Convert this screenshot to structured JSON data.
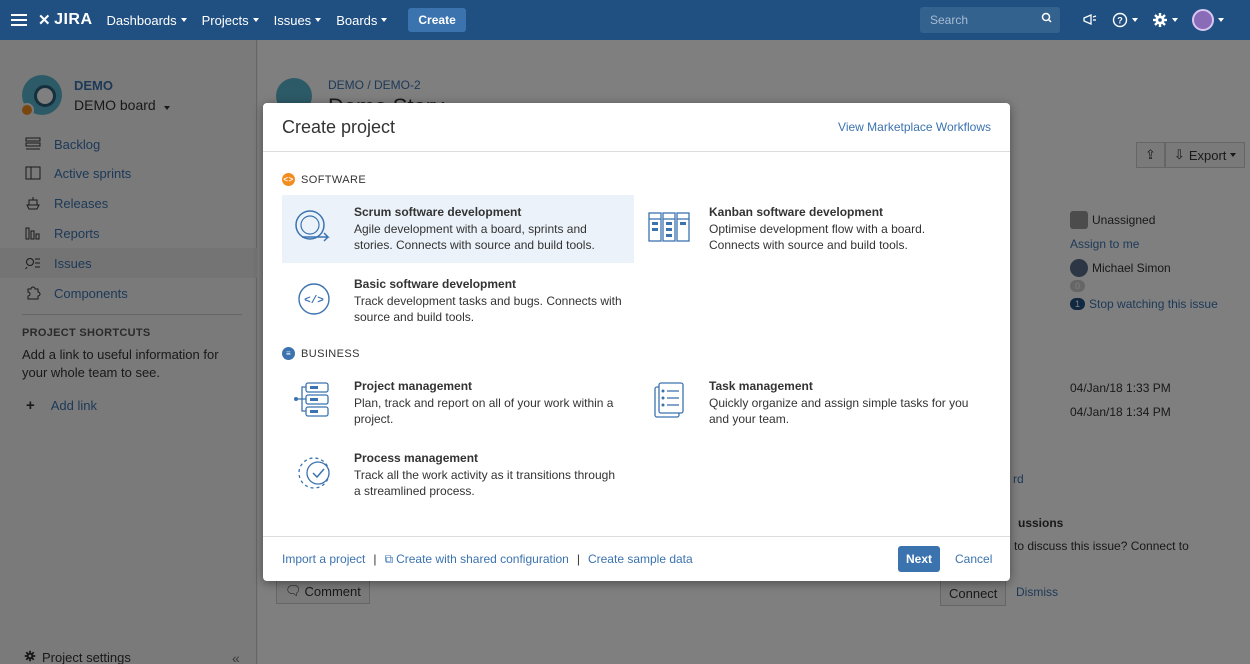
{
  "nav": {
    "logo": "JIRA",
    "items": [
      "Dashboards",
      "Projects",
      "Issues",
      "Boards"
    ],
    "create": "Create",
    "search_placeholder": "Search"
  },
  "sidebar": {
    "project_name": "DEMO",
    "board_name": "DEMO board",
    "items": [
      {
        "label": "Backlog",
        "icon": "backlog-icon"
      },
      {
        "label": "Active sprints",
        "icon": "sprint-icon"
      },
      {
        "label": "Releases",
        "icon": "ship-icon"
      },
      {
        "label": "Reports",
        "icon": "reports-icon"
      },
      {
        "label": "Issues",
        "icon": "issues-search-icon"
      },
      {
        "label": "Components",
        "icon": "puzzle-icon"
      }
    ],
    "shortcuts_title": "PROJECT SHORTCUTS",
    "shortcuts_text": "Add a link to useful information for your whole team to see.",
    "add_link": "Add link",
    "project_settings": "Project settings"
  },
  "issue": {
    "breadcrumb": "DEMO / DEMO-2",
    "title": "Demo Story",
    "export_label": "Export",
    "assignee": "Unassigned",
    "assign_to_me": "Assign to me",
    "reporter": "Michael Simon",
    "votes": "0",
    "watchers": "1",
    "stop_watching": "Stop watching this issue",
    "created": "04/Jan/18 1:33 PM",
    "updated": "04/Jan/18 1:34 PM",
    "board_link_fragment": "rd",
    "discussions_title": "ussions",
    "discussions_text": "to discuss this issue? Connect to",
    "connect": "Connect",
    "dismiss": "Dismiss",
    "comment": "Comment"
  },
  "dialog": {
    "title": "Create project",
    "marketplace_link": "View Marketplace Workflows",
    "software_label": "SOFTWARE",
    "business_label": "BUSINESS",
    "templates": {
      "scrum": {
        "name": "Scrum software development",
        "desc": "Agile development with a board, sprints and stories. Connects with source and build tools."
      },
      "kanban": {
        "name": "Kanban software development",
        "desc": "Optimise development flow with a board. Connects with source and build tools."
      },
      "basic": {
        "name": "Basic software development",
        "desc": "Track development tasks and bugs. Connects with source and build tools."
      },
      "project_mgmt": {
        "name": "Project management",
        "desc": "Plan, track and report on all of your work within a project."
      },
      "task_mgmt": {
        "name": "Task management",
        "desc": "Quickly organize and assign simple tasks for you and your team."
      },
      "process_mgmt": {
        "name": "Process management",
        "desc": "Track all the work activity as it transitions through a streamlined process."
      }
    },
    "footer": {
      "import": "Import a project",
      "shared_config": "Create with shared configuration",
      "sample_data": "Create sample data",
      "next": "Next",
      "cancel": "Cancel"
    }
  }
}
